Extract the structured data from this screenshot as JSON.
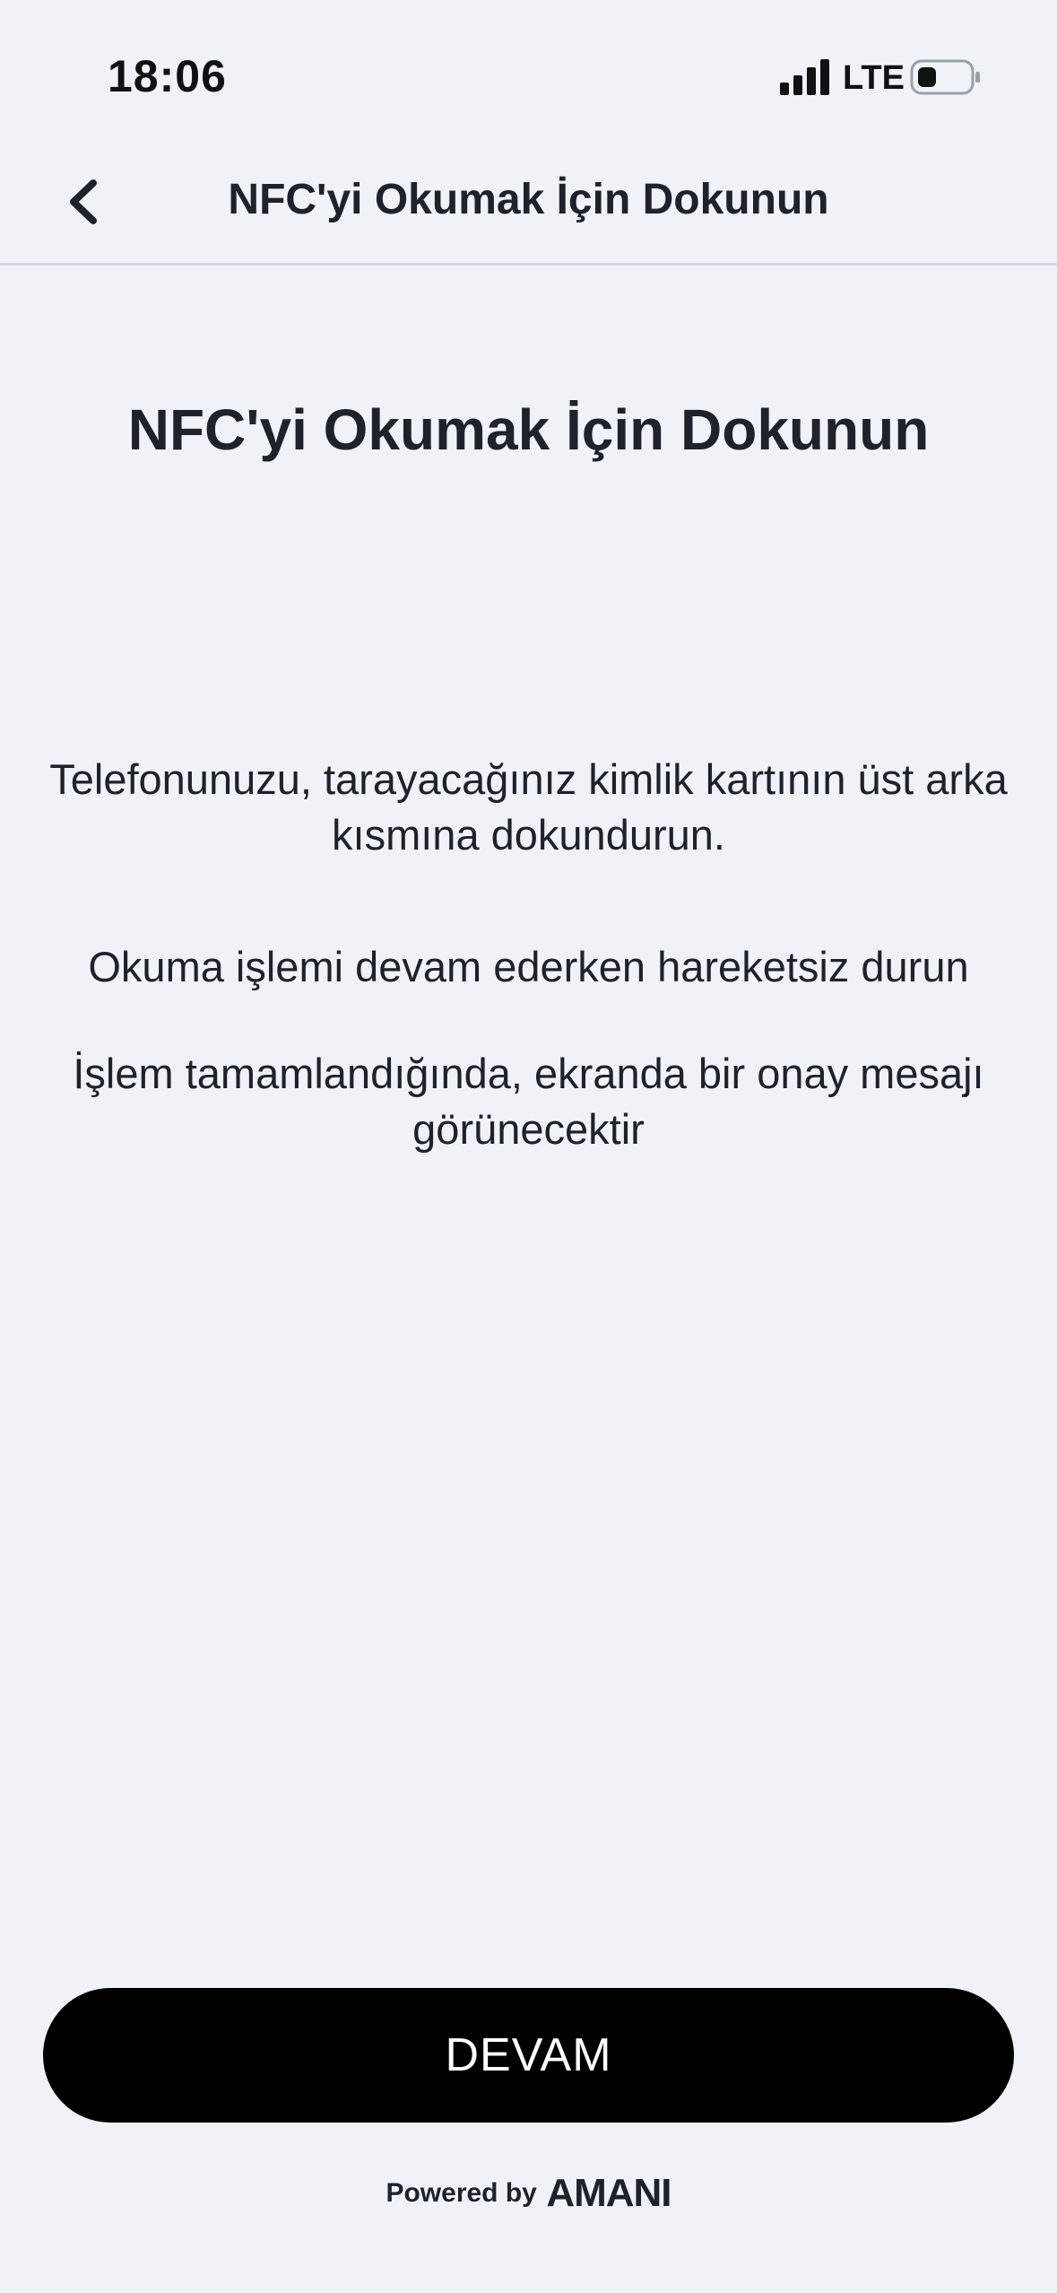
{
  "status_bar": {
    "time": "18:06",
    "network": "LTE",
    "icons": [
      "signal-icon",
      "battery-icon"
    ]
  },
  "nav": {
    "back_icon": "chevron-left-icon",
    "title": "NFC'yi Okumak İçin Dokunun"
  },
  "main": {
    "heading": "NFC'yi Okumak İçin Dokunun",
    "instructions": [
      "Telefonunuzu, tarayacağınız kimlik kartının üst arka kısmına dokundurun.",
      "Okuma işlemi devam ederken hareketsiz durun",
      "İşlem tamamlandığında, ekranda bir onay mesajı görünecektir"
    ]
  },
  "actions": {
    "continue_label": "DEVAM"
  },
  "footer": {
    "powered_by": "Powered by",
    "brand": "AMANI"
  },
  "colors": {
    "background": "#eff3f8",
    "text": "#1d222b",
    "button": "#000000",
    "button_text": "#ffffff"
  }
}
